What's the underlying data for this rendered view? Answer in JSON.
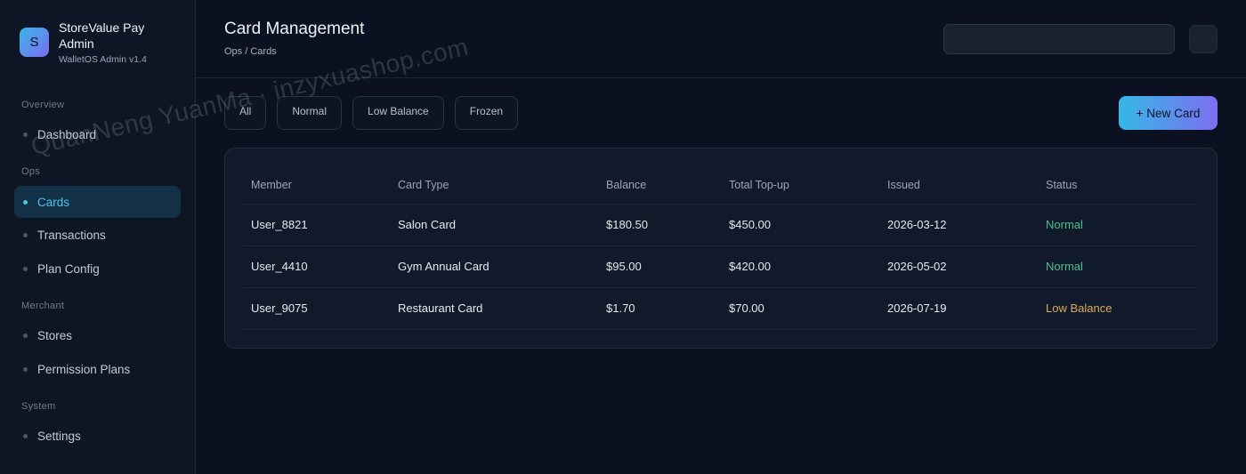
{
  "brand": {
    "logo_letter": "S",
    "name": "StoreValue Pay Admin",
    "subtitle": "WalletOS Admin v1.4"
  },
  "nav": {
    "sections": [
      {
        "label": "Overview",
        "items": [
          {
            "label": "Dashboard",
            "active": false
          }
        ]
      },
      {
        "label": "Ops",
        "items": [
          {
            "label": "Cards",
            "active": true
          },
          {
            "label": "Transactions",
            "active": false
          },
          {
            "label": "Plan Config",
            "active": false
          }
        ]
      },
      {
        "label": "Merchant",
        "items": [
          {
            "label": "Stores",
            "active": false
          },
          {
            "label": "Permission Plans",
            "active": false
          }
        ]
      },
      {
        "label": "System",
        "items": [
          {
            "label": "Settings",
            "active": false
          }
        ]
      }
    ]
  },
  "header": {
    "title": "Card Management",
    "breadcrumb": "Ops / Cards",
    "search_value": ""
  },
  "filters": [
    "All",
    "Normal",
    "Low Balance",
    "Frozen"
  ],
  "new_card_label": "+ New Card",
  "table": {
    "columns": [
      "Member",
      "Card Type",
      "Balance",
      "Total Top-up",
      "Issued",
      "Status"
    ],
    "rows": [
      [
        "User_8821",
        "Salon Card",
        "$180.50",
        "$450.00",
        "2026-03-12",
        "Normal"
      ],
      [
        "User_4410",
        "Gym Annual Card",
        "$95.00",
        "$420.00",
        "2026-05-02",
        "Normal"
      ],
      [
        "User_9075",
        "Restaurant Card",
        "$1.70",
        "$70.00",
        "2026-07-19",
        "Low Balance"
      ]
    ]
  },
  "watermark": "QuanNeng YuanMa · inzyxuashop.com",
  "colors": {
    "accent": "#4cc4ec",
    "status_normal": "#4fbf8e",
    "status_low": "#dca95c"
  }
}
